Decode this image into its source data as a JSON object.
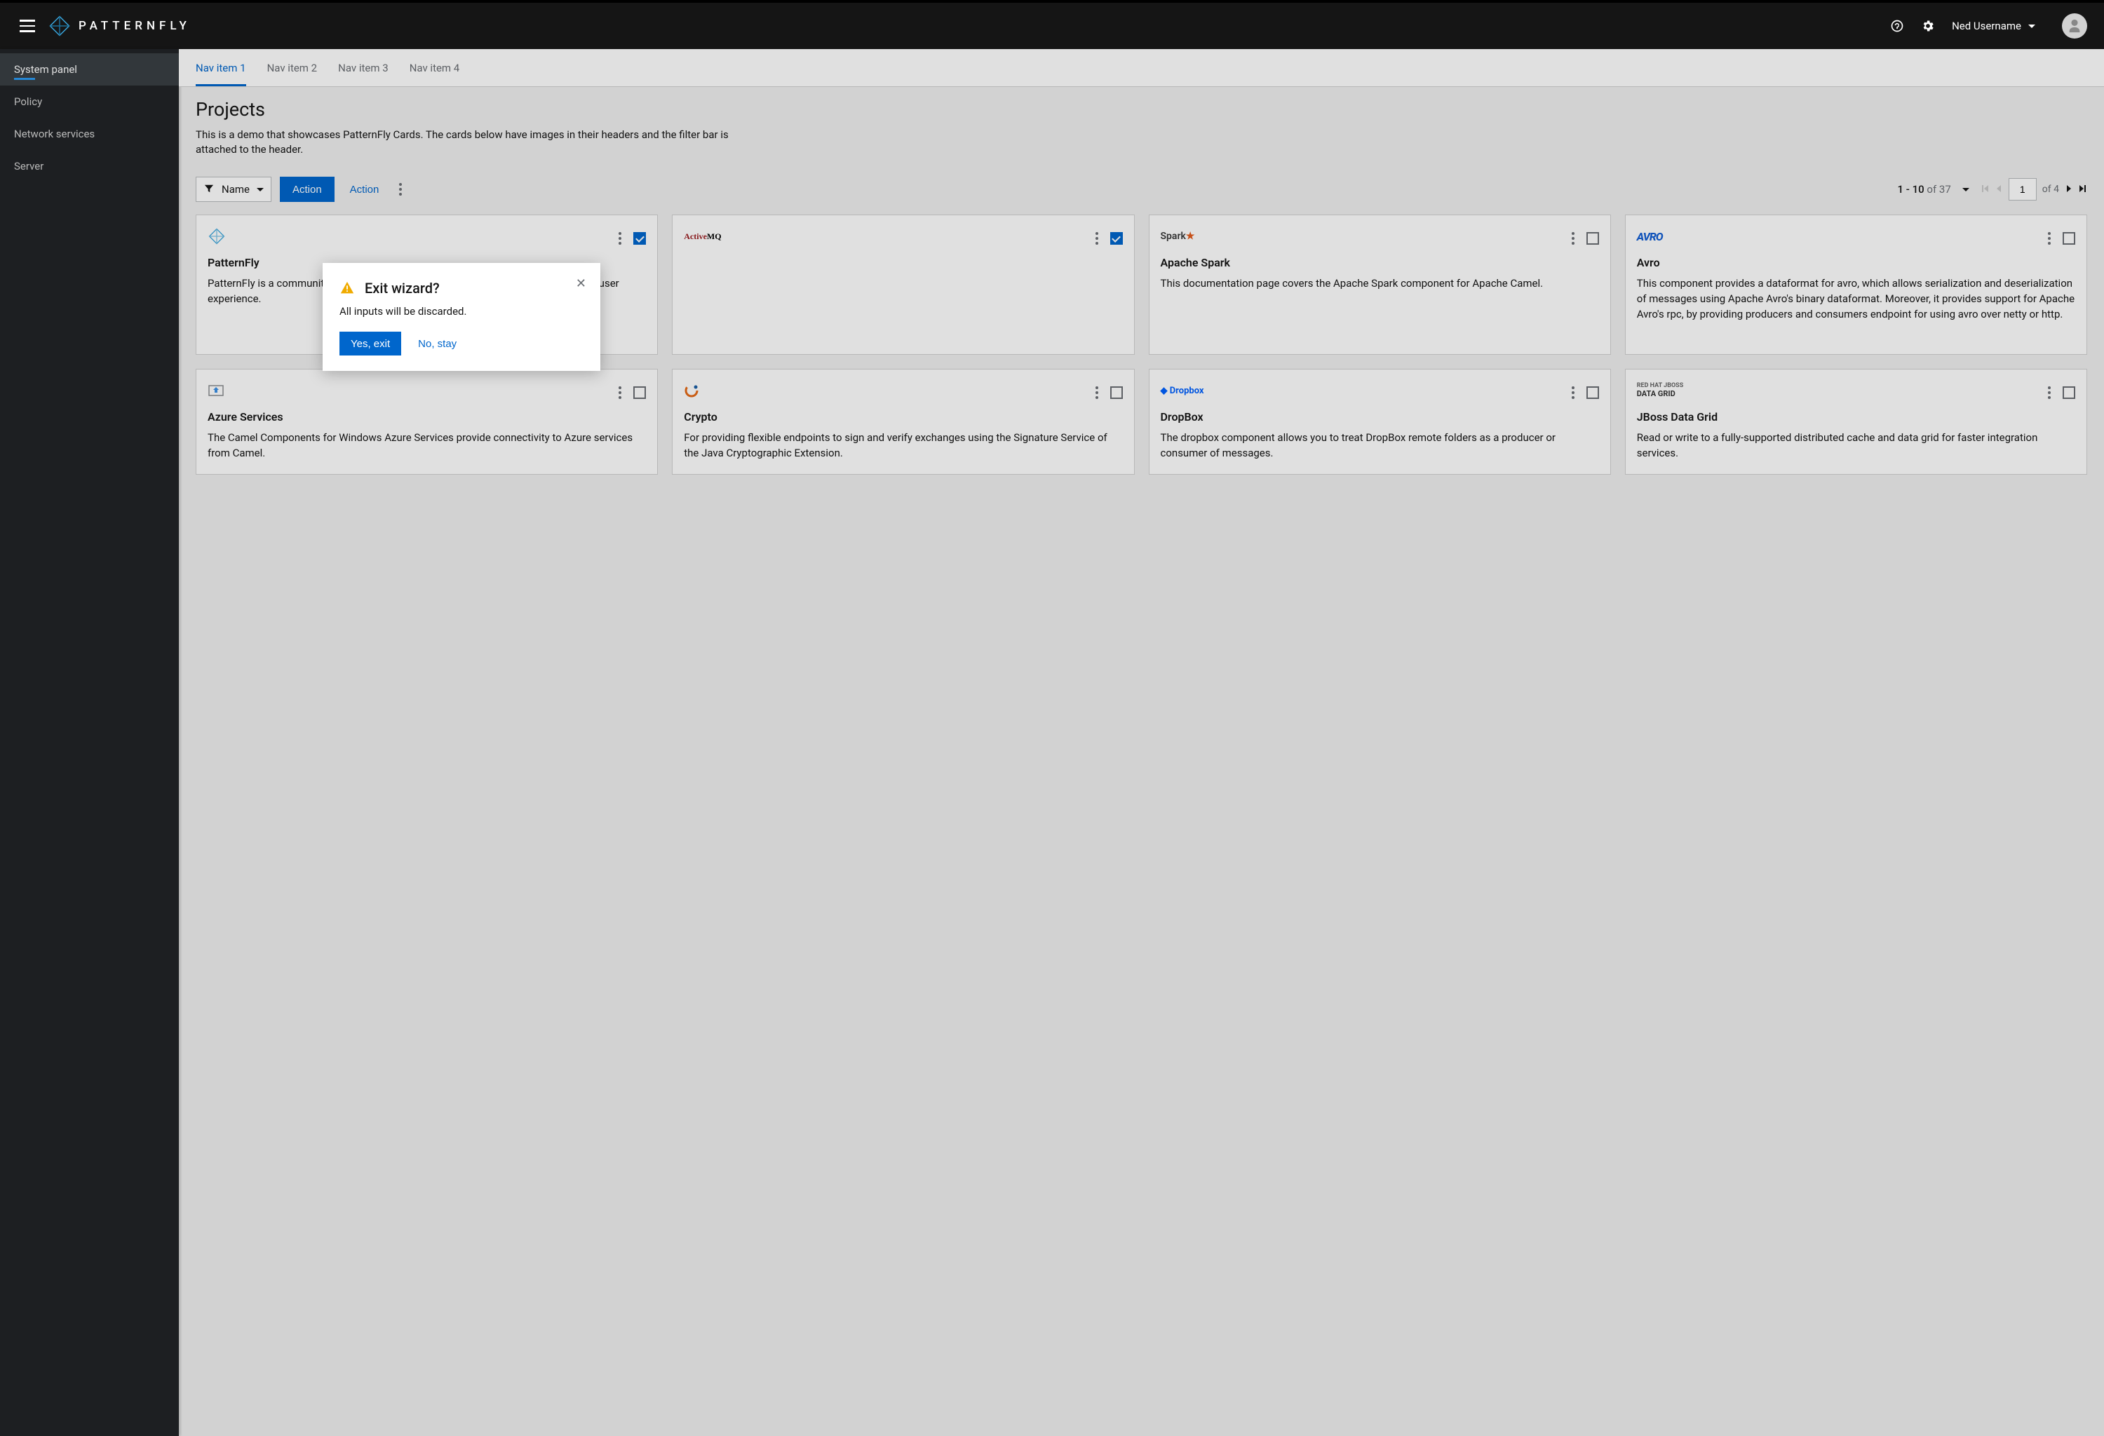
{
  "brand": {
    "name": "PATTERNFLY"
  },
  "user": {
    "name": "Ned Username"
  },
  "sidebar": {
    "items": [
      {
        "label": "System panel",
        "active": true
      },
      {
        "label": "Policy"
      },
      {
        "label": "Network services"
      },
      {
        "label": "Server"
      }
    ]
  },
  "tabs": [
    {
      "label": "Nav item 1",
      "active": true
    },
    {
      "label": "Nav item 2"
    },
    {
      "label": "Nav item 3"
    },
    {
      "label": "Nav item 4"
    }
  ],
  "page": {
    "title": "Projects",
    "description": "This is a demo that showcases PatternFly Cards. The cards below have images in their headers and the filter bar is attached to the header."
  },
  "toolbar": {
    "filter_label": "Name",
    "action_primary": "Action",
    "action_link": "Action"
  },
  "pagination": {
    "range": "1 - 10",
    "of_label": "of",
    "total": "37",
    "page_current": "1",
    "page_of_label": "of",
    "page_total": "4"
  },
  "cards": [
    {
      "title": "PatternFly",
      "body": "PatternFly is a community project that promotes design commonality and improves user experience.",
      "checked": true,
      "logo": "patternfly"
    },
    {
      "title": "",
      "body": "",
      "checked": true,
      "logo": "activemq"
    },
    {
      "title": "Apache Spark",
      "body": "This documentation page covers the Apache Spark component for Apache Camel.",
      "checked": false,
      "logo": "spark"
    },
    {
      "title": "Avro",
      "body": "This component provides a dataformat for avro, which allows serialization and deserialization of messages using Apache Avro's binary dataformat. Moreover, it provides support for Apache Avro's rpc, by providing producers and consumers endpoint for using avro over netty or http.",
      "checked": false,
      "logo": "avro"
    },
    {
      "title": "Azure Services",
      "body": "The Camel Components for Windows Azure Services provide connectivity to Azure services from Camel.",
      "checked": false,
      "logo": "azure"
    },
    {
      "title": "Crypto",
      "body": "For providing flexible endpoints to sign and verify exchanges using the Signature Service of the Java Cryptographic Extension.",
      "checked": false,
      "logo": "crypto"
    },
    {
      "title": "DropBox",
      "body": "The dropbox component allows you to treat DropBox remote folders as a producer or consumer of messages.",
      "checked": false,
      "logo": "dropbox"
    },
    {
      "title": "JBoss Data Grid",
      "body": "Read or write to a fully-supported distributed cache and data grid for faster integration services.",
      "checked": false,
      "logo": "jboss"
    }
  ],
  "modal": {
    "title": "Exit wizard?",
    "body": "All inputs will be discarded.",
    "confirm": "Yes, exit",
    "cancel": "No, stay"
  },
  "logos": {
    "activemq_html": "<span style='font-family:serif;'><span style='color:#9a1b1e;font-weight:800;'>Active</span><span style='color:#000;font-weight:800;'>MQ</span></span>",
    "spark_html": "<span style='color:#3a3a3a;font-weight:600;font-size:14px;'>Spark<span style='color:#e25a1c;'>&#9733;</span></span>",
    "avro_html": "<span style='color:#1560d4;font-weight:800;font-style:italic;font-size:16px;letter-spacing:-1px;'>AVRO</span>",
    "dropbox_html": "<span style='color:#0061ff;font-weight:700;font-size:13px;'>&#9670; Dropbox</span>",
    "jboss_html": "<span style='color:#666;font-size:9px;font-weight:700;line-height:1.1;'>RED HAT JBOSS<br><span style='font-size:11px;color:#333;'>DATA GRID</span></span>"
  }
}
